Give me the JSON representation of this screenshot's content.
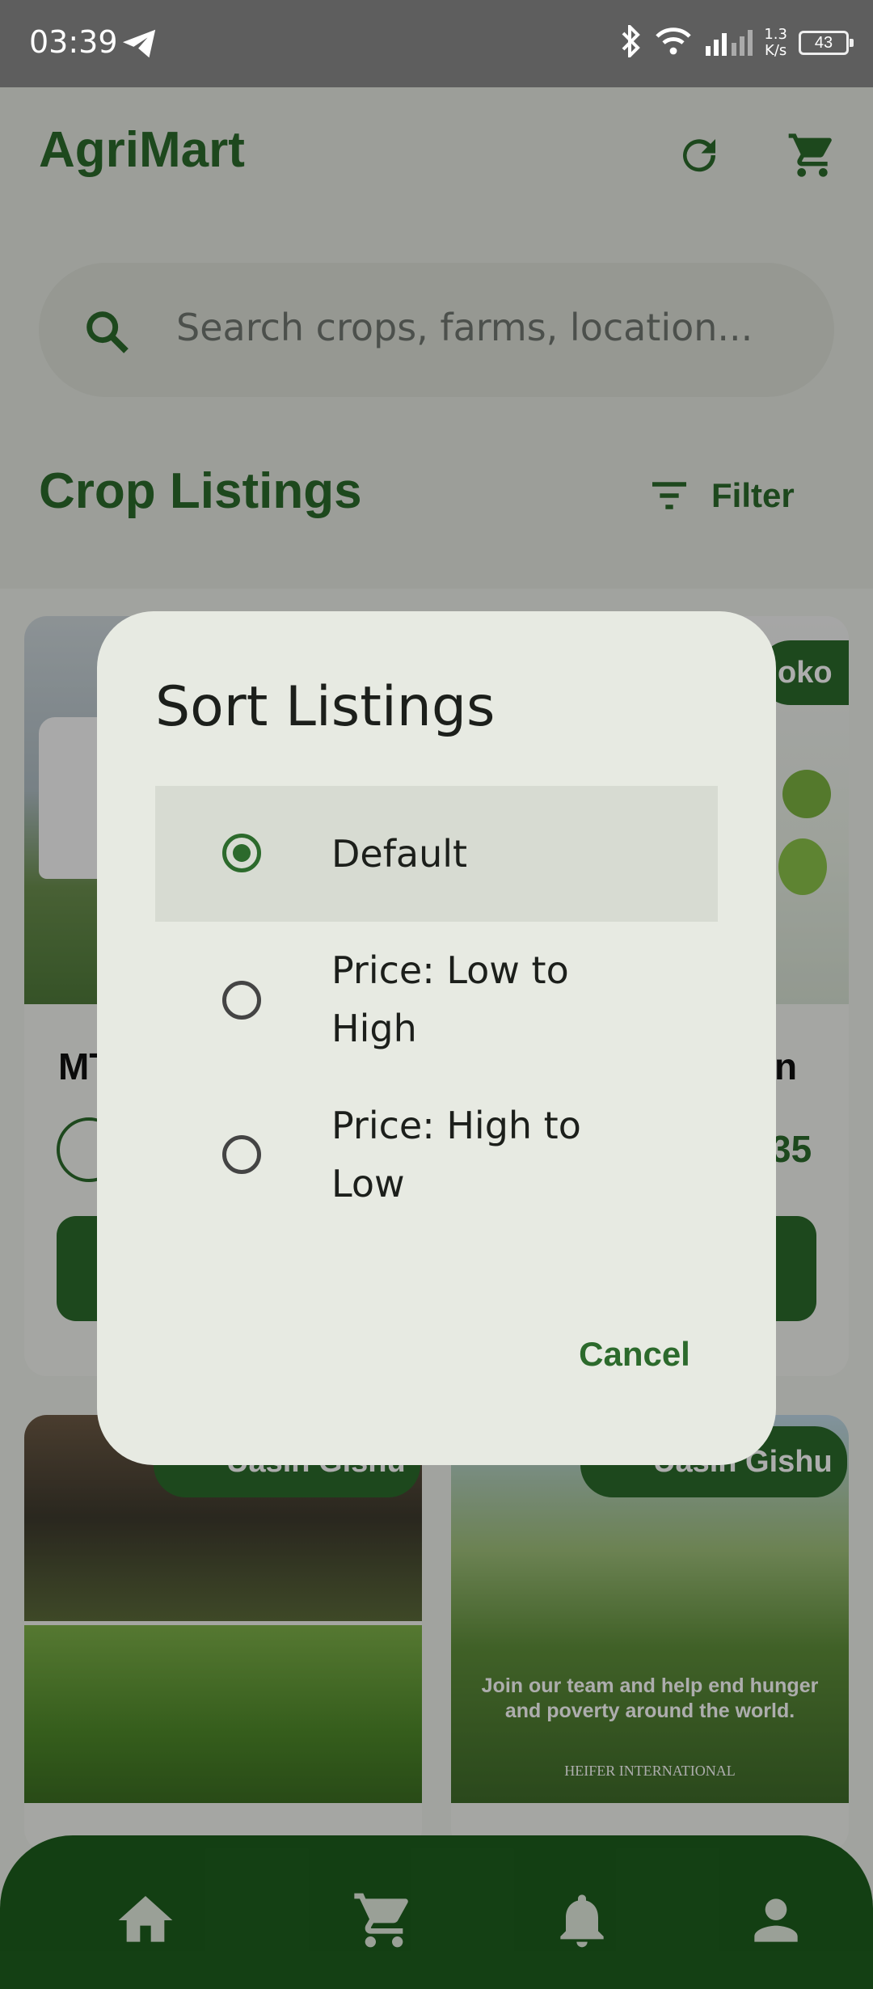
{
  "status_bar": {
    "time": "03:39",
    "net_speed_value": "1.3",
    "net_speed_unit": "K/s",
    "battery": "43"
  },
  "app_bar": {
    "title": "AgriMart"
  },
  "search": {
    "placeholder": "Search crops, farms, location..."
  },
  "section": {
    "title": "Crop Listings",
    "filter_label": "Filter"
  },
  "cards": [
    {
      "title_partial": "MT",
      "badge_partial": ""
    },
    {
      "title_partial": "n",
      "price_partial": "35",
      "badge_partial": "oko"
    },
    {
      "location": "Uasin Gishu"
    },
    {
      "location": "Uasin Gishu",
      "image_caption": "Join our team and help end hunger and poverty around the world.",
      "image_logo": "HEIFER INTERNATIONAL"
    }
  ],
  "dialog": {
    "title": "Sort Listings",
    "options": [
      {
        "label": "Default",
        "selected": true
      },
      {
        "label": "Price: Low to High",
        "selected": false
      },
      {
        "label": "Price: High to Low",
        "selected": false
      }
    ],
    "cancel_label": "Cancel"
  },
  "bottom_nav": {
    "items": [
      "home-icon",
      "cart-icon",
      "bell-icon",
      "person-icon"
    ]
  },
  "colors": {
    "primary": "#2c6a2c",
    "nav_bg": "#1d5e1d",
    "dialog_bg": "#e7eae2"
  }
}
